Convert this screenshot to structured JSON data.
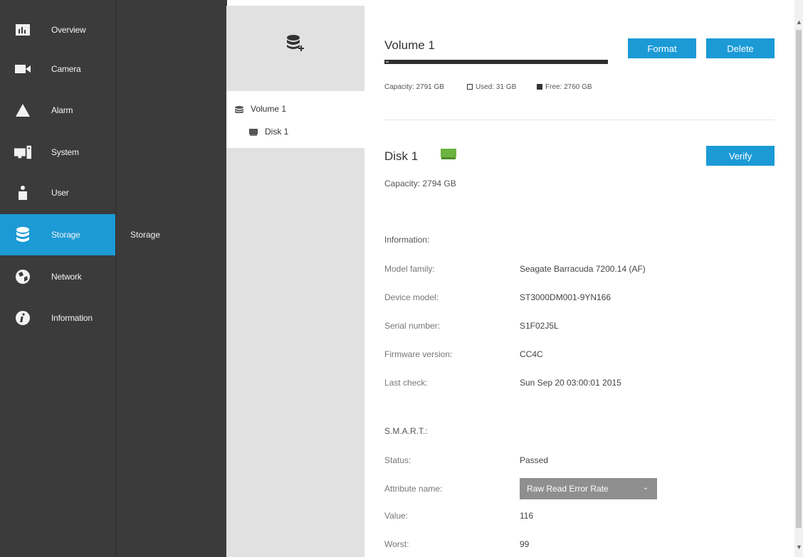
{
  "nav": {
    "items": [
      {
        "label": "Overview",
        "icon": "chart-icon"
      },
      {
        "label": "Camera",
        "icon": "camera-icon"
      },
      {
        "label": "Alarm",
        "icon": "alarm-icon"
      },
      {
        "label": "System",
        "icon": "system-icon"
      },
      {
        "label": "User",
        "icon": "user-icon"
      },
      {
        "label": "Storage",
        "icon": "storage-icon"
      },
      {
        "label": "Network",
        "icon": "network-icon"
      },
      {
        "label": "Information",
        "icon": "information-icon"
      }
    ],
    "active_index": 5,
    "sub_item": "Storage"
  },
  "tree": {
    "add_icon": "add-volume-icon",
    "items": [
      {
        "label": "Volume 1",
        "icon": "volume-icon"
      },
      {
        "label": "Disk 1",
        "icon": "disk-icon"
      }
    ]
  },
  "volume": {
    "title": "Volume 1",
    "format_label": "Format",
    "delete_label": "Delete",
    "capacity_text": "Capacity: 2791 GB",
    "used_text": "Used: 31 GB",
    "free_text": "Free: 2760 GB",
    "used_fraction": 0.011
  },
  "disk": {
    "title": "Disk 1",
    "status_icon_color": "#6cb33f",
    "verify_label": "Verify",
    "capacity_text": "Capacity: 2794 GB"
  },
  "information": {
    "heading": "Information:",
    "rows": [
      {
        "label": "Model family:",
        "value": "Seagate Barracuda 7200.14 (AF)"
      },
      {
        "label": "Device model:",
        "value": "ST3000DM001-9YN166"
      },
      {
        "label": "Serial number:",
        "value": "S1F02J5L"
      },
      {
        "label": "Firmware version:",
        "value": "CC4C"
      },
      {
        "label": "Last check:",
        "value": "Sun Sep 20 03:00:01 2015"
      }
    ]
  },
  "smart": {
    "heading": "S.M.A.R.T.:",
    "status_label": "Status:",
    "status_value": "Passed",
    "attribute_label": "Attribute name:",
    "attribute_value": "Raw Read Error Rate",
    "value_label": "Value:",
    "value_value": "116",
    "worst_label": "Worst:",
    "worst_value": "99"
  },
  "colors": {
    "accent": "#1b9ad6",
    "nav_bg": "#3b3b3b",
    "tree_bg": "#e1e1e1"
  }
}
